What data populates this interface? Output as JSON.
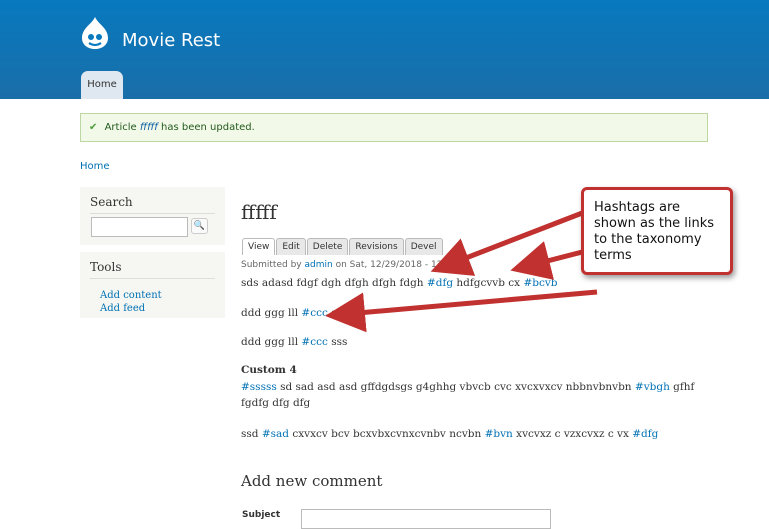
{
  "site": {
    "name": "Movie Rest",
    "logo_icon": "drupal-drop-icon"
  },
  "nav": {
    "home_tab": "Home"
  },
  "message": {
    "prefix": "Article",
    "link": "fffff",
    "suffix": "has been updated."
  },
  "breadcrumb": {
    "home": "Home"
  },
  "sidebar": {
    "search": {
      "title": "Search"
    },
    "tools": {
      "title": "Tools",
      "links": [
        "Add content",
        "Add feed"
      ]
    }
  },
  "article": {
    "title": "fffff",
    "tabs": [
      "View",
      "Edit",
      "Delete",
      "Revisions",
      "Devel"
    ],
    "submitted_prefix": "Submitted by",
    "author": "admin",
    "submitted_suffix": "on Sat, 12/29/2018 - 13:58",
    "p1": {
      "text1": "sds adasd fdgf dgh dfgh dfgh fdgh ",
      "tag1": "#dfg",
      "text2": " hdfgcvvb cx ",
      "tag2": "#bcvb"
    },
    "p2": {
      "text1": "ddd ggg lll ",
      "tag1": "#ccc",
      "text2": " sss"
    },
    "p3": {
      "text1": "ddd ggg lll ",
      "tag1": "#ccc",
      "text2": " sss"
    },
    "custom_label": "Custom 4",
    "p4": {
      "tag1": "#sssss",
      "text1": " sd sad asd asd gffdgdsgs g4ghhg vbvcb cvc xvcxvxcv nbbnvbnvbn ",
      "tag2": "#vbgh",
      "text2": " gfhf  fgdfg dfg dfg"
    },
    "p5": {
      "text1": "ssd ",
      "tag1": "#sad",
      "text2": " cxvxcv bcv bcxvbxcvnxcvnbv ncvbn ",
      "tag2": "#bvn",
      "text3": " xvcvxz c vzxcvxz c vx ",
      "tag3": "#dfg"
    }
  },
  "comment": {
    "heading": "Add new comment",
    "subject_label": "Subject"
  },
  "annotation": {
    "text": "Hashtags are shown as the links to the taxonomy terms",
    "color": "#c0312f"
  }
}
